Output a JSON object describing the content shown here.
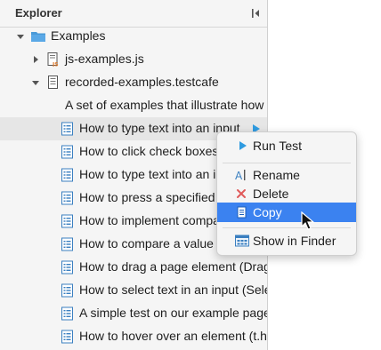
{
  "explorer": {
    "title": "Explorer",
    "collapse_icon": "collapse-sidebar-icon"
  },
  "tree": {
    "root": {
      "label": "Examples",
      "icon": "folder-icon",
      "expanded": true
    },
    "js_file": {
      "label": "js-examples.js",
      "icon": "js-file-icon",
      "expanded": false
    },
    "testcafe_file": {
      "label": "recorded-examples.testcafe",
      "icon": "testcafe-file-icon",
      "expanded": true
    },
    "description": "A set of examples that illustrate how",
    "tests": [
      "How to type text into an input",
      "How to click check boxes",
      "How to type text into an i",
      "How to press a specified",
      "How to implement compa",
      "How to compare a value",
      "How to drag a page element (Drag",
      "How to select text in an input (Sele",
      "A simple test on our example page",
      "How to hover over an element (t.h"
    ]
  },
  "context_menu": {
    "run_test": "Run Test",
    "rename": "Rename",
    "delete": "Delete",
    "copy": "Copy",
    "show_in_finder": "Show in Finder",
    "active_item": "Copy"
  },
  "colors": {
    "accent": "#3b82f0",
    "run": "#2f9be0",
    "delete": "#e05a5a",
    "folder": "#4a9ad8",
    "js_badge": "#e07a2a"
  }
}
